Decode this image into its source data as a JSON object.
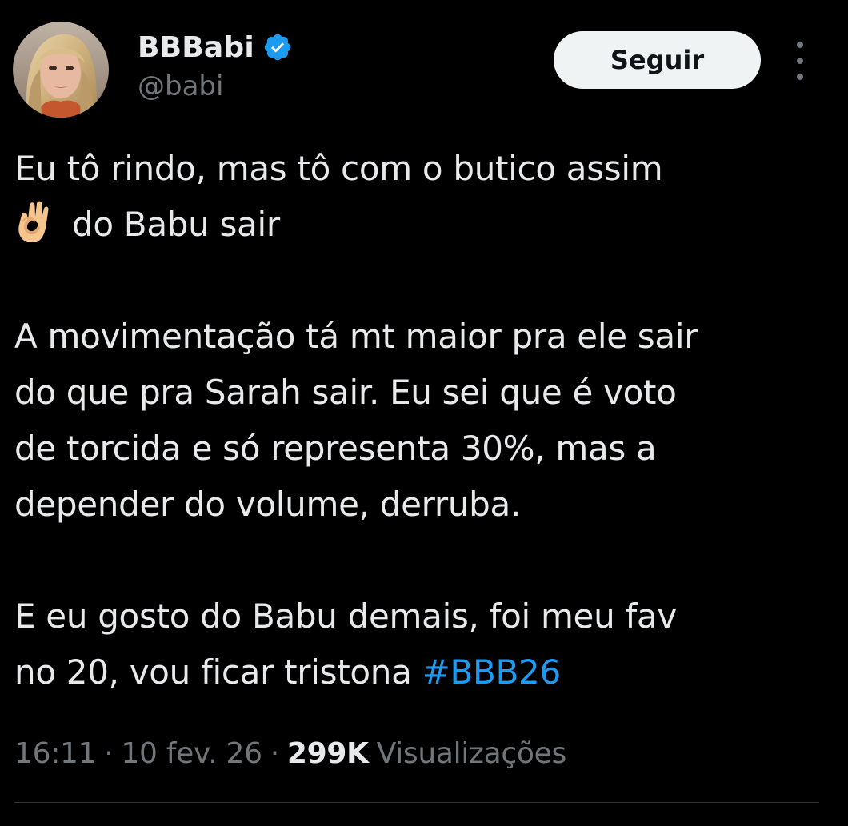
{
  "author": {
    "display_name": "BBBabi",
    "handle": "@babi",
    "verified": true,
    "verified_color": "#1d9bf0"
  },
  "follow_button": {
    "label": "Seguir"
  },
  "more_menu": {
    "icon": "more-vertical-icon"
  },
  "tweet": {
    "lines": {
      "l1": "Eu tô rindo, mas tô com o butico assim",
      "l2_emoji": "👌",
      "l2": "do Babu sair",
      "l3": "A movimentação tá mt maior pra ele sair",
      "l4": "do que pra Sarah sair. Eu sei que é voto",
      "l5": "de torcida e só representa 30%, mas a",
      "l6": "depender do volume, derruba.",
      "l7": "E eu gosto do Babu demais, foi meu fav",
      "l8": "no 20, vou ficar tristona "
    },
    "hashtag": "#BBB26",
    "hashtag_color": "#1d9bf0"
  },
  "meta": {
    "time": "16:11",
    "separator": "·",
    "date": "10 fev. 26",
    "views_count": "299K",
    "views_label": "Visualizações"
  },
  "colors": {
    "background": "#000000",
    "text": "#e7e9ea",
    "secondary": "#71767b",
    "button_bg": "#eff3f4",
    "button_text": "#0f1419"
  }
}
